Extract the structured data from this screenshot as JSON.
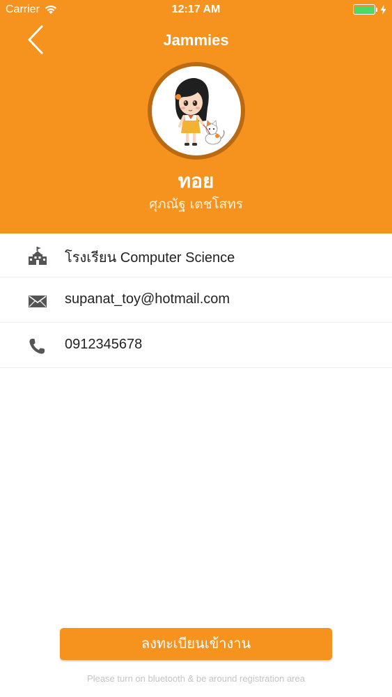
{
  "status_bar": {
    "carrier": "Carrier",
    "time": "12:17 AM",
    "battery_color": "#4cd964"
  },
  "header": {
    "title": "Jammies",
    "back_icon": "chevron-left-icon",
    "background_color": "#f5931e"
  },
  "profile": {
    "avatar": "cartoon-girl-with-cat-avatar",
    "name": "ทอย",
    "full_name": "ศุภณัฐ เตชโสทร"
  },
  "info": {
    "school": {
      "icon": "school-building-icon",
      "text": "โรงเรียน Computer Science"
    },
    "email": {
      "icon": "envelope-icon",
      "text": "supanat_toy@hotmail.com"
    },
    "phone": {
      "icon": "phone-icon",
      "text": "0912345678"
    }
  },
  "footer": {
    "register_label": "ลงทะเบียนเข้างาน",
    "hint": "Please turn on bluetooth & be around registration area",
    "accent_color": "#f5931e"
  }
}
